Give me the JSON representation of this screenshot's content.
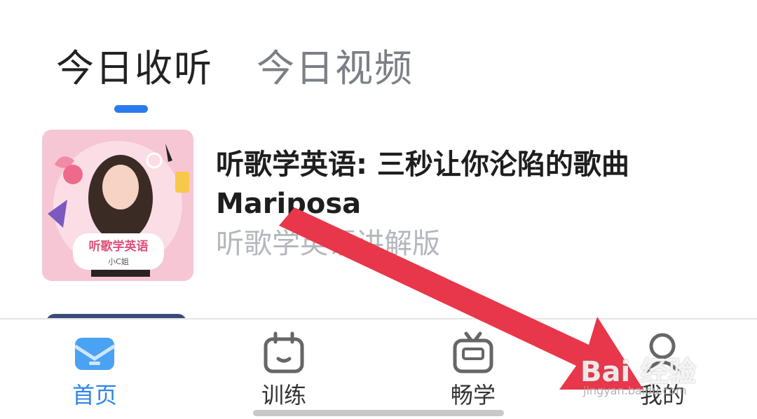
{
  "tabs": [
    {
      "label": "今日收听",
      "active": true
    },
    {
      "label": "今日视频",
      "active": false
    }
  ],
  "item": {
    "thumbnail_text": "听歌学英语",
    "thumbnail_subtext": "小C姐",
    "title": "听歌学英语: 三秒让你沦陷的歌曲 Mariposa",
    "subtitle": "听歌学英语讲解版"
  },
  "nav": [
    {
      "label": "首页",
      "icon": "mail-icon",
      "active": true
    },
    {
      "label": "训练",
      "icon": "calendar-icon",
      "active": false
    },
    {
      "label": "畅学",
      "icon": "tv-icon",
      "active": false
    },
    {
      "label": "我的",
      "icon": "profile-icon",
      "active": false
    }
  ],
  "watermark": {
    "text": "Bai 经验",
    "sub": "jingyan.baidu.com"
  },
  "colors": {
    "accent": "#2d86ea",
    "arrow": "#e8374a"
  }
}
